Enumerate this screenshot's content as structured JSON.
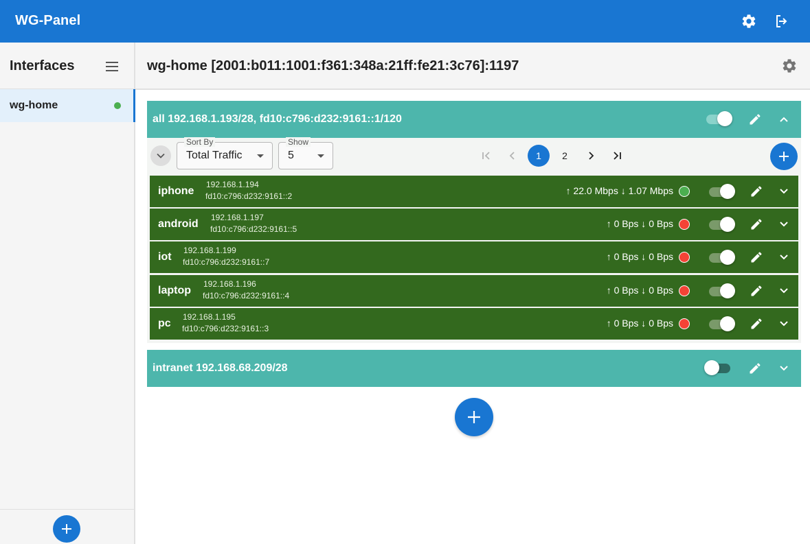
{
  "app": {
    "title": "WG-Panel",
    "icons": {
      "settings": "gear-icon",
      "logout": "logout-icon"
    }
  },
  "sidebar": {
    "title": "Interfaces",
    "items": [
      {
        "label": "wg-home",
        "status": "online"
      }
    ]
  },
  "main": {
    "title": "wg-home [2001:b011:1001:f361:348a:21ff:fe21:3c76]:1197"
  },
  "groups": [
    {
      "title": "all 192.168.1.193/28, fd10:c796:d232:9161::1/120",
      "enabled": true,
      "expanded": true
    },
    {
      "title": "intranet 192.168.68.209/28",
      "enabled": false,
      "expanded": false
    }
  ],
  "controls": {
    "sort_label": "Sort By",
    "sort_value": "Total Traffic",
    "show_label": "Show",
    "show_value": "5",
    "pages": [
      "1",
      "2"
    ],
    "current_page": "1"
  },
  "peers": [
    {
      "name": "iphone",
      "ipv4": "192.168.1.194",
      "ipv6": "fd10:c796:d232:9161::2",
      "traffic": "↑ 22.0 Mbps ↓ 1.07 Mbps",
      "online": true,
      "enabled": true
    },
    {
      "name": "android",
      "ipv4": "192.168.1.197",
      "ipv6": "fd10:c796:d232:9161::5",
      "traffic": "↑ 0 Bps ↓ 0 Bps",
      "online": false,
      "enabled": true
    },
    {
      "name": "iot",
      "ipv4": "192.168.1.199",
      "ipv6": "fd10:c796:d232:9161::7",
      "traffic": "↑ 0 Bps ↓ 0 Bps",
      "online": false,
      "enabled": true
    },
    {
      "name": "laptop",
      "ipv4": "192.168.1.196",
      "ipv6": "fd10:c796:d232:9161::4",
      "traffic": "↑ 0 Bps ↓ 0 Bps",
      "online": false,
      "enabled": true
    },
    {
      "name": "pc",
      "ipv4": "192.168.1.195",
      "ipv6": "fd10:c796:d232:9161::3",
      "traffic": "↑ 0 Bps ↓ 0 Bps",
      "online": false,
      "enabled": true
    }
  ],
  "colors": {
    "primary": "#1976d2",
    "group": "#4db6ac",
    "peer": "#33691e",
    "online": "#4caf50",
    "offline": "#f44336"
  }
}
